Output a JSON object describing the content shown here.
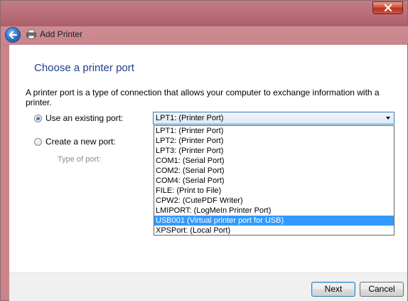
{
  "window": {
    "title": "Add Printer",
    "close_icon": "close-icon",
    "back_icon": "back-arrow-icon",
    "title_icon": "printer-icon"
  },
  "page": {
    "heading": "Choose a printer port",
    "description": "A printer port is a type of connection that allows your computer to exchange information with a printer."
  },
  "options": {
    "existing_label": "Use an existing port:",
    "new_label": "Create a new port:",
    "type_label": "Type of port:",
    "existing_selected": true
  },
  "port_combo": {
    "value": "LPT1: (Printer Port)",
    "items": [
      "LPT1: (Printer Port)",
      "LPT2: (Printer Port)",
      "LPT3: (Printer Port)",
      "COM1: (Serial Port)",
      "COM2: (Serial Port)",
      "COM4: (Serial Port)",
      "FILE: (Print to File)",
      "CPW2: (CutePDF Writer)",
      "LMIPORT: (LogMeIn Printer Port)",
      "USB001 (Virtual printer port for USB)",
      "XPSPort: (Local Port)"
    ],
    "highlighted_index": 9
  },
  "buttons": {
    "next": "Next",
    "cancel": "Cancel"
  },
  "colors": {
    "title_tint": "#c07e86",
    "heading": "#1f3c8c",
    "selection": "#3399ff"
  }
}
